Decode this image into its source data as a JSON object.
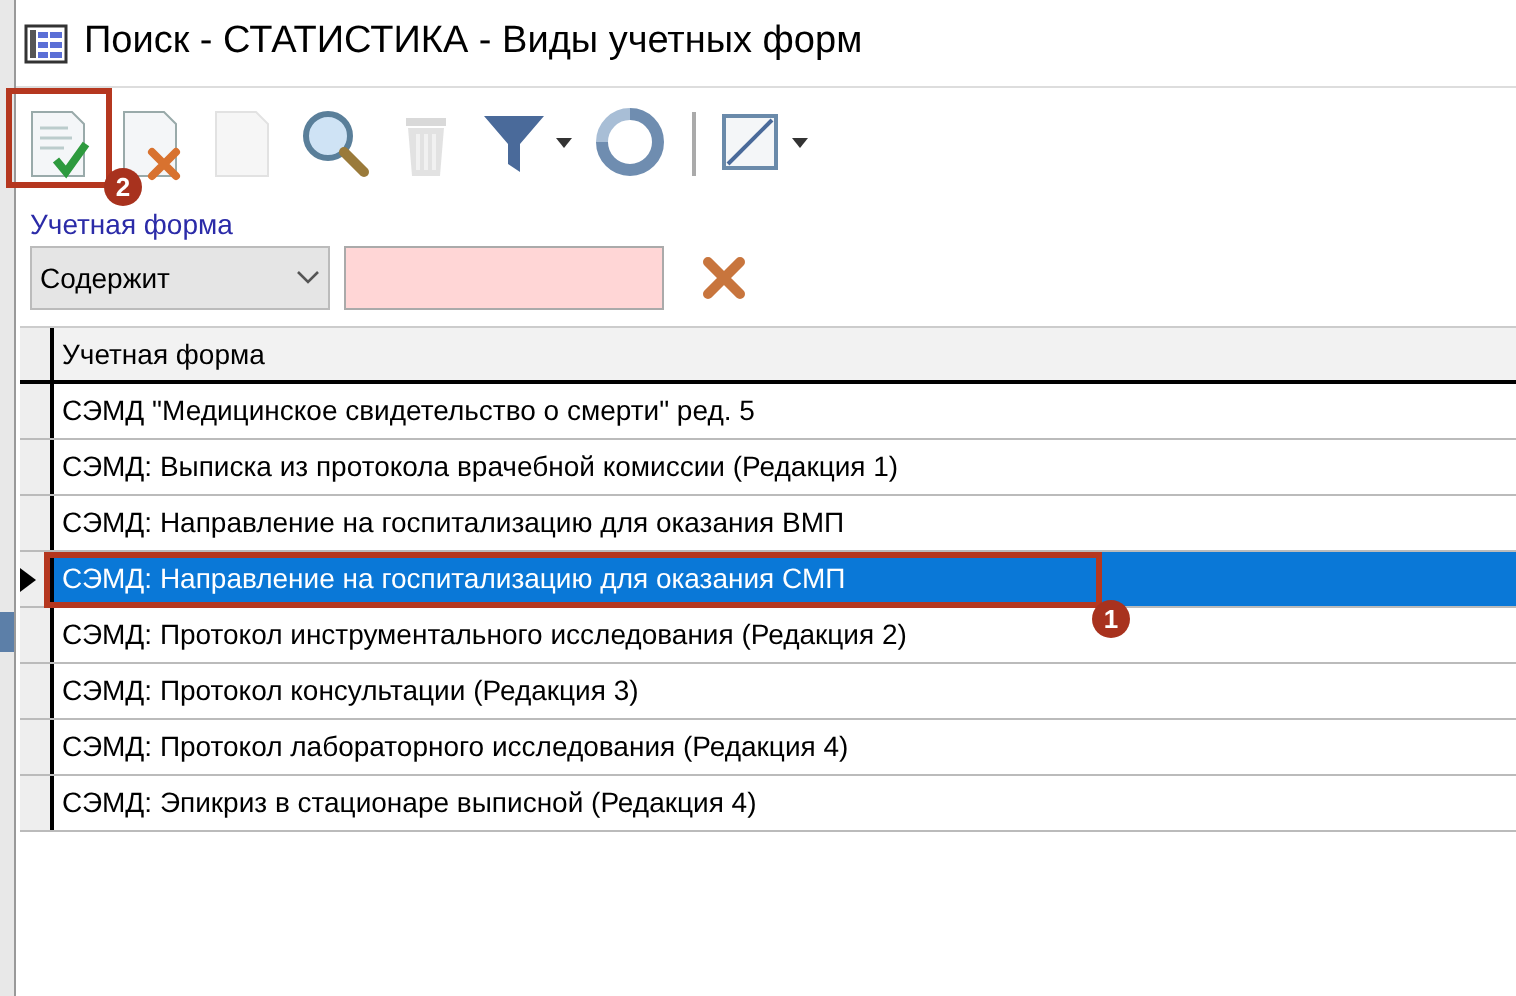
{
  "window": {
    "title": "Поиск - СТАТИСТИКА - Виды учетных форм"
  },
  "toolbar": [
    {
      "kind": "accept",
      "disabled": false,
      "callout": "2"
    },
    {
      "kind": "remove",
      "disabled": false
    },
    {
      "kind": "blank",
      "disabled": true
    },
    {
      "kind": "search",
      "disabled": false
    },
    {
      "kind": "trash",
      "disabled": true
    },
    {
      "kind": "filter",
      "disabled": false
    },
    {
      "kind": "refresh",
      "disabled": false
    },
    {
      "kind": "separator"
    },
    {
      "kind": "ruler",
      "disabled": false
    }
  ],
  "filter": {
    "label": "Учетная форма",
    "operator": "Содержит"
  },
  "table": {
    "columns": [
      "Учетная форма"
    ],
    "rows": [
      {
        "text": "СЭМД \"Медицинское свидетельство о смерти\" ред. 5",
        "selected": false
      },
      {
        "text": "СЭМД: Выписка из протокола врачебной комиссии (Редакция 1)",
        "selected": false
      },
      {
        "text": "СЭМД: Направление на госпитализацию для оказания ВМП",
        "selected": false
      },
      {
        "text": "СЭМД: Направление на госпитализацию для оказания СМП",
        "selected": true,
        "callout": "1"
      },
      {
        "text": "СЭМД: Протокол инструментального исследования (Редакция 2)",
        "selected": false
      },
      {
        "text": "СЭМД: Протокол консультации (Редакция 3)",
        "selected": false
      },
      {
        "text": "СЭМД: Протокол лабораторного исследования (Редакция 4)",
        "selected": false
      },
      {
        "text": "СЭМД: Эпикриз в стационаре выписной (Редакция 4)",
        "selected": false
      }
    ]
  }
}
